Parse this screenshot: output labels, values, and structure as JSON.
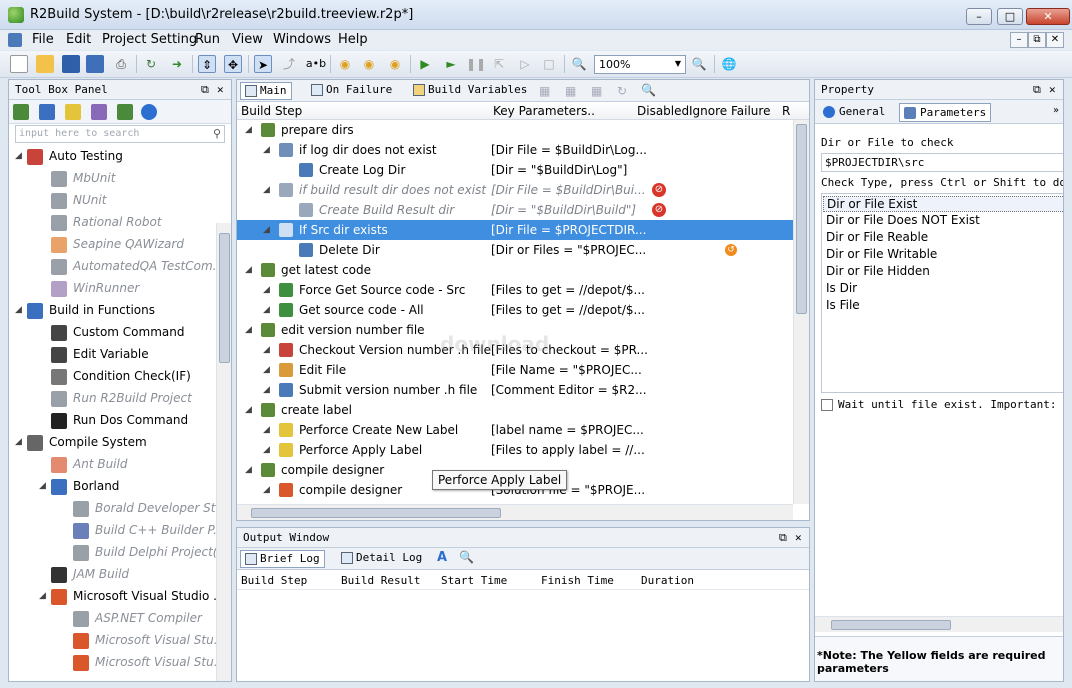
{
  "window": {
    "title": "R2Build System - [D:\\build\\r2release\\r2build.treeview.r2p*]"
  },
  "menu": [
    "File",
    "Edit",
    "Project Setting",
    "Run",
    "View",
    "Windows",
    "Help"
  ],
  "toolbar": {
    "zoom": "100%"
  },
  "toolbox": {
    "title": "Tool Box Panel",
    "search_placeholder": "input here to search",
    "items": [
      {
        "label": "Auto Testing",
        "level": 0,
        "expanded": true,
        "disabled": false,
        "icon": "auto-testing-icon",
        "color": "#c8443a"
      },
      {
        "label": "MbUnit",
        "level": 1,
        "disabled": true,
        "icon": "mbunit-icon",
        "color": "#9aa0a8"
      },
      {
        "label": "NUnit",
        "level": 1,
        "disabled": true,
        "icon": "nunit-icon",
        "color": "#9aa0a8"
      },
      {
        "label": "Rational Robot",
        "level": 1,
        "disabled": true,
        "icon": "rational-robot-icon",
        "color": "#9aa0a8"
      },
      {
        "label": "Seapine QAWizard",
        "level": 1,
        "disabled": true,
        "icon": "qawizard-icon",
        "color": "#e9a36a"
      },
      {
        "label": "AutomatedQA TestCom...",
        "level": 1,
        "disabled": true,
        "icon": "testcomplete-icon",
        "color": "#9aa0a8"
      },
      {
        "label": "WinRunner",
        "level": 1,
        "disabled": true,
        "icon": "winrunner-icon",
        "color": "#b3a0c6"
      },
      {
        "label": "Build in Functions",
        "level": 0,
        "expanded": true,
        "disabled": false,
        "icon": "functions-icon",
        "color": "#3b6fc0"
      },
      {
        "label": "Custom Command",
        "level": 1,
        "disabled": false,
        "icon": "custom-command-icon",
        "color": "#444"
      },
      {
        "label": "Edit Variable",
        "level": 1,
        "disabled": false,
        "icon": "edit-variable-icon",
        "color": "#444"
      },
      {
        "label": "Condition Check(IF)",
        "level": 1,
        "disabled": false,
        "icon": "condition-icon",
        "color": "#777"
      },
      {
        "label": "Run R2Build Project",
        "level": 1,
        "disabled": true,
        "icon": "run-project-icon",
        "color": "#9aa0a8"
      },
      {
        "label": "Run Dos Command",
        "level": 1,
        "disabled": false,
        "icon": "dos-icon",
        "color": "#222"
      },
      {
        "label": "Compile System",
        "level": 0,
        "expanded": true,
        "disabled": false,
        "icon": "compile-system-icon",
        "color": "#666"
      },
      {
        "label": "Ant Build",
        "level": 1,
        "disabled": true,
        "icon": "ant-icon",
        "color": "#e48a6f"
      },
      {
        "label": "Borland",
        "level": 1,
        "expanded": true,
        "disabled": false,
        "icon": "borland-icon",
        "color": "#3b6fc0"
      },
      {
        "label": "Borald Developer St...",
        "level": 2,
        "disabled": true,
        "icon": "borland-dev-icon",
        "color": "#9aa0a8"
      },
      {
        "label": "Build C++ Builder P...",
        "level": 2,
        "disabled": true,
        "icon": "cbuilder-icon",
        "color": "#6b7fb8"
      },
      {
        "label": "Build Delphi Project(...",
        "level": 2,
        "disabled": true,
        "icon": "delphi-icon",
        "color": "#9aa0a8"
      },
      {
        "label": "JAM Build",
        "level": 1,
        "disabled": true,
        "icon": "jam-icon",
        "color": "#333"
      },
      {
        "label": "Microsoft Visual Studio ...",
        "level": 1,
        "expanded": true,
        "disabled": false,
        "icon": "visual-studio-icon",
        "color": "#d9572a"
      },
      {
        "label": "ASP.NET Compiler",
        "level": 2,
        "disabled": true,
        "icon": "aspnet-icon",
        "color": "#9aa0a8"
      },
      {
        "label": "Microsoft Visual Stu...",
        "level": 2,
        "disabled": true,
        "icon": "vs-icon",
        "color": "#d9572a"
      },
      {
        "label": "Microsoft Visual Stu...",
        "level": 2,
        "disabled": true,
        "icon": "vs-icon",
        "color": "#d9572a"
      }
    ]
  },
  "main": {
    "tabs": [
      "Main",
      "On Failure",
      "Build Variables"
    ],
    "columns": [
      "Build Step",
      "Key Parameters..",
      "Disabled",
      "Ignore Failure",
      "R"
    ],
    "rows": [
      {
        "level": 0,
        "label": "prepare dirs",
        "params": "",
        "icon": "group-icon",
        "color": "#5a8a3a",
        "state": "normal",
        "flag": ""
      },
      {
        "level": 1,
        "label": "if log dir does not exist",
        "params": "[Dir File = $BuildDir\\Log...",
        "icon": "condition-icon",
        "color": "#6f8fb8",
        "state": "normal",
        "flag": ""
      },
      {
        "level": 2,
        "label": "Create Log Dir",
        "params": "[Dir = \"$BuildDir\\Log\"]",
        "icon": "folder-icon",
        "color": "#4a7ab8",
        "state": "normal",
        "flag": ""
      },
      {
        "level": 1,
        "label": "if build result dir does not exist",
        "params": "[Dir File = $BuildDir\\Bui...",
        "icon": "condition-icon",
        "color": "#9aa8bb",
        "state": "disabled",
        "flag": "stop"
      },
      {
        "level": 2,
        "label": "Create Build Result dir",
        "params": "[Dir = \"$BuildDir\\Build\"]",
        "icon": "folder-icon",
        "color": "#9aa8bb",
        "state": "disabled",
        "flag": "stop"
      },
      {
        "level": 1,
        "label": "If Src dir exists",
        "params": "[Dir File = $PROJECTDIR...",
        "icon": "condition-icon",
        "color": "#cfe0f5",
        "state": "selected",
        "flag": ""
      },
      {
        "level": 2,
        "label": "Delete Dir",
        "params": "[Dir or Files = \"$PROJEC...",
        "icon": "delete-icon",
        "color": "#4a7ab8",
        "state": "normal",
        "flag": "undo"
      },
      {
        "level": 0,
        "label": "get latest code",
        "params": "",
        "icon": "group-icon",
        "color": "#5a8a3a",
        "state": "normal",
        "flag": ""
      },
      {
        "level": 1,
        "label": "Force Get Source code - Src",
        "params": "[Files to get = //depot/$...",
        "icon": "get-icon",
        "color": "#3e8f3e",
        "state": "normal",
        "flag": ""
      },
      {
        "level": 1,
        "label": "Get source code - All",
        "params": "[Files to get = //depot/$...",
        "icon": "get-icon",
        "color": "#3e8f3e",
        "state": "normal",
        "flag": ""
      },
      {
        "level": 0,
        "label": "edit version number file",
        "params": "",
        "icon": "group-icon",
        "color": "#5a8a3a",
        "state": "normal",
        "flag": ""
      },
      {
        "level": 1,
        "label": "Checkout Version number .h file",
        "params": "[Files to checkout = $PR...",
        "icon": "checkout-icon",
        "color": "#c8443a",
        "state": "normal",
        "flag": ""
      },
      {
        "level": 1,
        "label": "Edit File",
        "params": "[File Name = \"$PROJEC...",
        "icon": "edit-file-icon",
        "color": "#d99a3a",
        "state": "normal",
        "flag": ""
      },
      {
        "level": 1,
        "label": "Submit version number .h file",
        "params": "[Comment Editor = $R2...",
        "icon": "submit-icon",
        "color": "#4a7ab8",
        "state": "normal",
        "flag": ""
      },
      {
        "level": 0,
        "label": "create label",
        "params": "",
        "icon": "group-icon",
        "color": "#5a8a3a",
        "state": "normal",
        "flag": ""
      },
      {
        "level": 1,
        "label": "Perforce Create New Label",
        "params": "[label name = $PROJEC...",
        "icon": "label-icon",
        "color": "#e3c43a",
        "state": "normal",
        "flag": ""
      },
      {
        "level": 1,
        "label": "Perforce Apply Label",
        "params": "[Files to apply label = //...",
        "icon": "label-icon",
        "color": "#e3c43a",
        "state": "normal",
        "flag": ""
      },
      {
        "level": 0,
        "label": "compile designer",
        "params": "",
        "icon": "group-icon",
        "color": "#5a8a3a",
        "state": "normal",
        "flag": ""
      },
      {
        "level": 1,
        "label": "compile designer",
        "params": "[Solution file = \"$PROJE...",
        "icon": "vs-icon",
        "color": "#d9572a",
        "state": "normal",
        "flag": ""
      }
    ],
    "tooltip": "Perforce Apply Label"
  },
  "output": {
    "title": "Output Window",
    "tabs": [
      "Brief Log",
      "Detail Log"
    ],
    "columns": [
      "Build Step",
      "Build Result",
      "Start Time",
      "Finish Time",
      "Duration"
    ]
  },
  "property": {
    "title": "Property",
    "tabs": [
      "General",
      "Parameters"
    ],
    "dir_label": "Dir or File to check",
    "dir_value": "$PROJECTDIR\\src",
    "check_label": "Check Type, press Ctrl or Shift to do mu",
    "check_options": [
      "Dir or File Exist",
      "Dir or File Does NOT Exist",
      "Dir or File Reable",
      "Dir or File Writable",
      "Dir or File Hidden",
      "Is Dir",
      "Is File"
    ],
    "wait_label": "Wait until file exist. Important: it ",
    "note": "*Note: The Yellow fields are required parameters"
  },
  "watermark": "download"
}
